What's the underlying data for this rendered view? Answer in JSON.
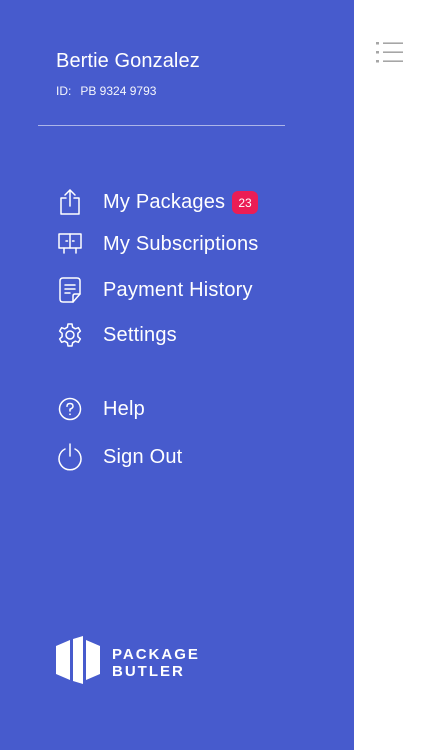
{
  "colors": {
    "drawer_background": "#475bcd",
    "badge_background": "#eb1d55",
    "hamburger": "#a6a6a6"
  },
  "user": {
    "name": "Bertie Gonzalez",
    "id_label": "ID:",
    "id_value": "PB 9324 9793"
  },
  "menu": {
    "items": [
      {
        "label": "My Packages",
        "icon": "share-upload-icon",
        "badge": "23"
      },
      {
        "label": "My Subscriptions",
        "icon": "subscriptions-icon"
      },
      {
        "label": "Payment History",
        "icon": "document-icon"
      },
      {
        "label": "Settings",
        "icon": "gear-icon"
      },
      {
        "label": "Help",
        "icon": "help-circle-icon"
      },
      {
        "label": "Sign Out",
        "icon": "power-icon"
      }
    ]
  },
  "brand": {
    "line1": "PACKAGE",
    "line2": "BUTLER",
    "icon": "box-logo-icon"
  },
  "header": {
    "menu_icon": "hamburger-menu-icon"
  }
}
